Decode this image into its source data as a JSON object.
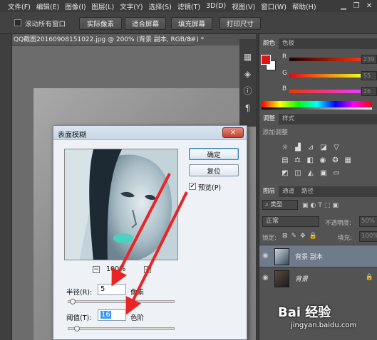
{
  "menubar": {
    "items": [
      "文件(F)",
      "编辑(E)",
      "图像(I)",
      "图层(L)",
      "文字(Y)",
      "选择(S)",
      "滤镜(T)",
      "3D(D)",
      "视图(V)",
      "窗口(W)",
      "帮助(H)"
    ]
  },
  "optionsbar": {
    "scroll_all": "滚动所有窗口",
    "buttons": [
      "实际像素",
      "适合屏幕",
      "填充屏幕",
      "打印尺寸"
    ]
  },
  "document": {
    "tab_title": "QQ截图20160908151022.jpg @ 200% (背景 副本, RGB/8#) *",
    "close": "×"
  },
  "color_panel": {
    "tabs": [
      "颜色",
      "色板"
    ],
    "channels": [
      {
        "label": "R",
        "value": "239"
      },
      {
        "label": "G",
        "value": "55"
      },
      {
        "label": "B",
        "value": "26"
      }
    ],
    "foreground_color": "#e21212"
  },
  "adjustments_panel": {
    "tabs": [
      "调整",
      "样式"
    ],
    "heading": "添加调整"
  },
  "layers_panel": {
    "tabs": [
      "图层",
      "通道",
      "路径"
    ],
    "filter_kind": "类型",
    "blend_mode": "正常",
    "opacity_label": "不透明度:",
    "opacity_value": "50%",
    "lock_label": "锁定:",
    "fill_label": "填充:",
    "fill_value": "100%",
    "layers": [
      {
        "name": "背景 副本",
        "active": true
      },
      {
        "name": "背景",
        "active": false
      }
    ]
  },
  "dialog": {
    "title": "表面模糊",
    "close": "×",
    "ok_label": "确定",
    "reset_label": "复位",
    "preview_label": "预览(P)",
    "zoom_level": "100%",
    "zoom_minus": "−",
    "zoom_plus": "+",
    "radius_label": "半径(R):",
    "radius_value": "5",
    "radius_unit": "像素",
    "radius_fraction": 0.02,
    "threshold_label": "阈值(T):",
    "threshold_value": "16",
    "threshold_unit": "色阶",
    "threshold_fraction": 0.06
  },
  "watermark": {
    "logo": "Bai 经验",
    "url": "jingyan.baidu.com"
  }
}
